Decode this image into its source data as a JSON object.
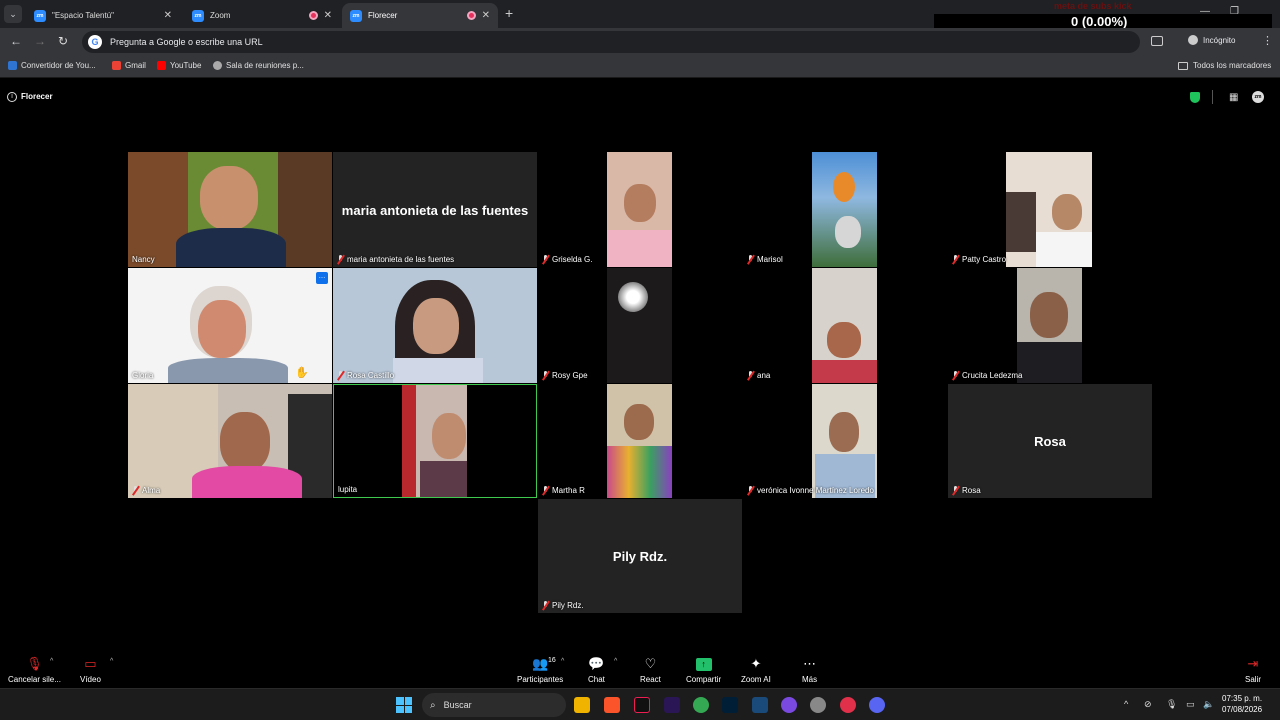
{
  "browser": {
    "tabs": [
      {
        "title": "\"Espacio Talentú\"",
        "favicon": "zm"
      },
      {
        "title": "Zoom",
        "favicon": "zm"
      },
      {
        "title": "Florecer",
        "favicon": "zm"
      }
    ],
    "omnibox_placeholder": "Pregunta a Google o escribe una URL",
    "incognito_label": "Incógnito",
    "bookmarks": [
      "Convertidor de You...",
      "Gmail",
      "YouTube",
      "Sala de reuniones p..."
    ],
    "all_bookmarks_label": "Todos los marcadores"
  },
  "stream_overlay": {
    "goal_label": "meta de subs kick",
    "count": "0 (0.00%)",
    "value": "0"
  },
  "meeting": {
    "title": "Florecer",
    "participants": [
      {
        "name": "Nancy",
        "video": true,
        "muted": false
      },
      {
        "name": "maria antonieta de las fuentes",
        "video": false,
        "muted": true
      },
      {
        "name": "Griselda G.",
        "video": true,
        "muted": true
      },
      {
        "name": "Marisol",
        "video": true,
        "muted": true
      },
      {
        "name": "Patty Castro",
        "video": true,
        "muted": true
      },
      {
        "name": "Gloria",
        "video": true,
        "muted": false
      },
      {
        "name": "Rosa Castillo",
        "video": true,
        "muted": true
      },
      {
        "name": "Rosy Gpe",
        "video": true,
        "muted": true
      },
      {
        "name": "ana",
        "video": true,
        "muted": true
      },
      {
        "name": "Crucita Ledezma",
        "video": true,
        "muted": true
      },
      {
        "name": "Alma",
        "video": true,
        "muted": true
      },
      {
        "name": "lupita",
        "video": true,
        "muted": false
      },
      {
        "name": "Martha R",
        "video": true,
        "muted": true
      },
      {
        "name": "verónica Ivonne Martínez Loredo",
        "video": true,
        "muted": true
      },
      {
        "name": "Rosa",
        "video": false,
        "muted": true
      },
      {
        "name": "Pily Rdz.",
        "video": false,
        "muted": true
      }
    ]
  },
  "controls": {
    "mute": "Cancelar sile...",
    "video": "Vídeo",
    "participants": "Participantes",
    "participants_count": "16",
    "chat": "Chat",
    "react": "React",
    "share": "Compartir",
    "zoom_ai": "Zoom AI",
    "more": "Más",
    "leave": "Salir"
  },
  "taskbar": {
    "search_placeholder": "Buscar",
    "time": "07:35 p. m.",
    "date": "07/08/2026"
  },
  "colors": {
    "zoom_blue": "#2d8cff",
    "share_green": "#22c06b",
    "shield_green": "#1fc35c",
    "mute_red": "#e02828",
    "active_speaker": "#3fc94f"
  }
}
